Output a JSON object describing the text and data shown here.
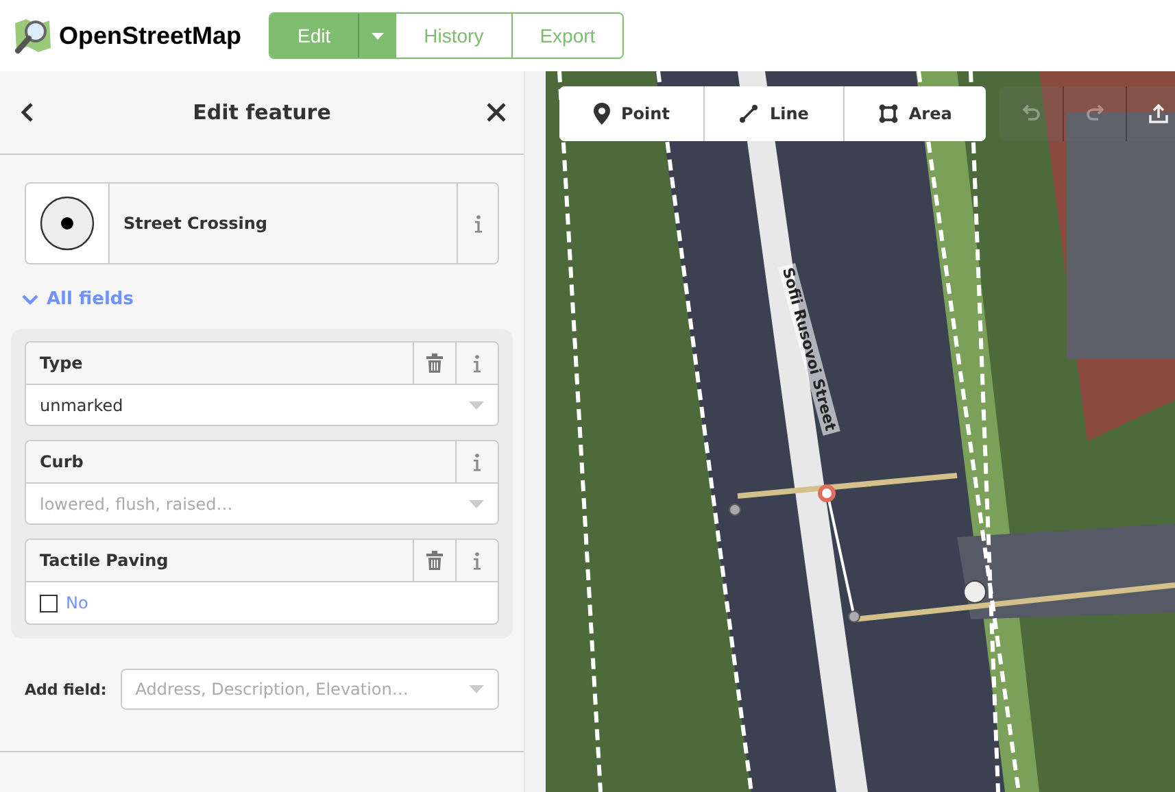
{
  "header": {
    "logo": "OpenStreetMap",
    "nav": [
      {
        "label": "Edit",
        "selected": true,
        "dropdown": true
      },
      {
        "label": "History",
        "selected": false,
        "dropdown": false
      },
      {
        "label": "Export",
        "selected": false,
        "dropdown": false
      }
    ]
  },
  "sidebar": {
    "title": "Edit feature",
    "preset": {
      "name": "Street Crossing"
    },
    "section": {
      "label": "All fields",
      "expanded": true
    },
    "fields": [
      {
        "label": "Type",
        "removable": true,
        "kind": "combo",
        "value": "unmarked"
      },
      {
        "label": "Curb",
        "removable": false,
        "kind": "combo",
        "placeholder": "lowered, flush, raised…"
      },
      {
        "label": "Tactile Paving",
        "removable": true,
        "kind": "check",
        "value": "No",
        "checked": false
      }
    ],
    "add_field": {
      "label": "Add field:",
      "placeholder": "Address, Description, Elevation…"
    }
  },
  "map": {
    "modes": [
      {
        "label": "Point",
        "kind": "point"
      },
      {
        "label": "Line",
        "kind": "line"
      },
      {
        "label": "Area",
        "kind": "area"
      }
    ],
    "actions": [
      {
        "kind": "undo",
        "disabled": true
      },
      {
        "kind": "redo",
        "disabled": true
      },
      {
        "kind": "share",
        "disabled": false
      }
    ],
    "street_label": "Sofii Rusovoi Street"
  }
}
